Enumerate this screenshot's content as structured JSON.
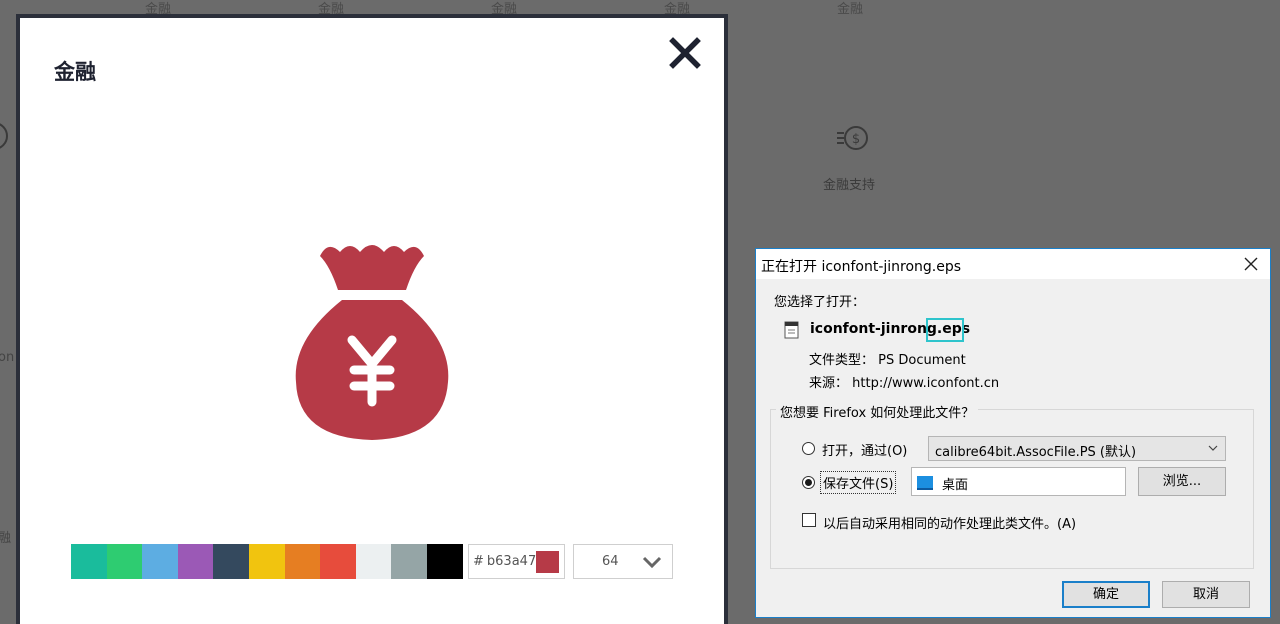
{
  "background": {
    "top_labels": [
      "金融",
      "金融",
      "金融",
      "金融",
      "金融"
    ],
    "left_edge_text": [
      "on",
      "融"
    ],
    "icon_label": "金融支持"
  },
  "preview": {
    "title": "金融",
    "close_icon": "close-icon",
    "main_icon": "money-bag-yuan-icon",
    "icon_color": "#b63a47",
    "palette": [
      "#1abc9c",
      "#2ecc71",
      "#5dade2",
      "#9b59b6",
      "#34495e",
      "#f1c40f",
      "#e67e22",
      "#e74c3c",
      "#ecf0f1",
      "#95a5a6",
      "#000000"
    ],
    "hex_prefix": "#",
    "hex_value": "b63a47",
    "size_value": "64"
  },
  "dialog": {
    "title": "正在打开 iconfont-jinrong.eps",
    "chose_text": "您选择了打开：",
    "filename": "iconfont-jinrong.eps",
    "file_type": "文件类型： PS Document",
    "source": "来源： http://www.iconfont.cn",
    "question": "您想要 Firefox 如何处理此文件？",
    "open_label": "打开，通过(O)",
    "open_app": "calibre64bit.AssocFile.PS (默认)",
    "save_label": "保存文件(S)",
    "save_location": "桌面",
    "browse_label": "浏览...",
    "auto_label": "以后自动采用相同的动作处理此类文件。(A)",
    "ok_label": "确定",
    "cancel_label": "取消",
    "accent_color": "#1a7fc9"
  }
}
